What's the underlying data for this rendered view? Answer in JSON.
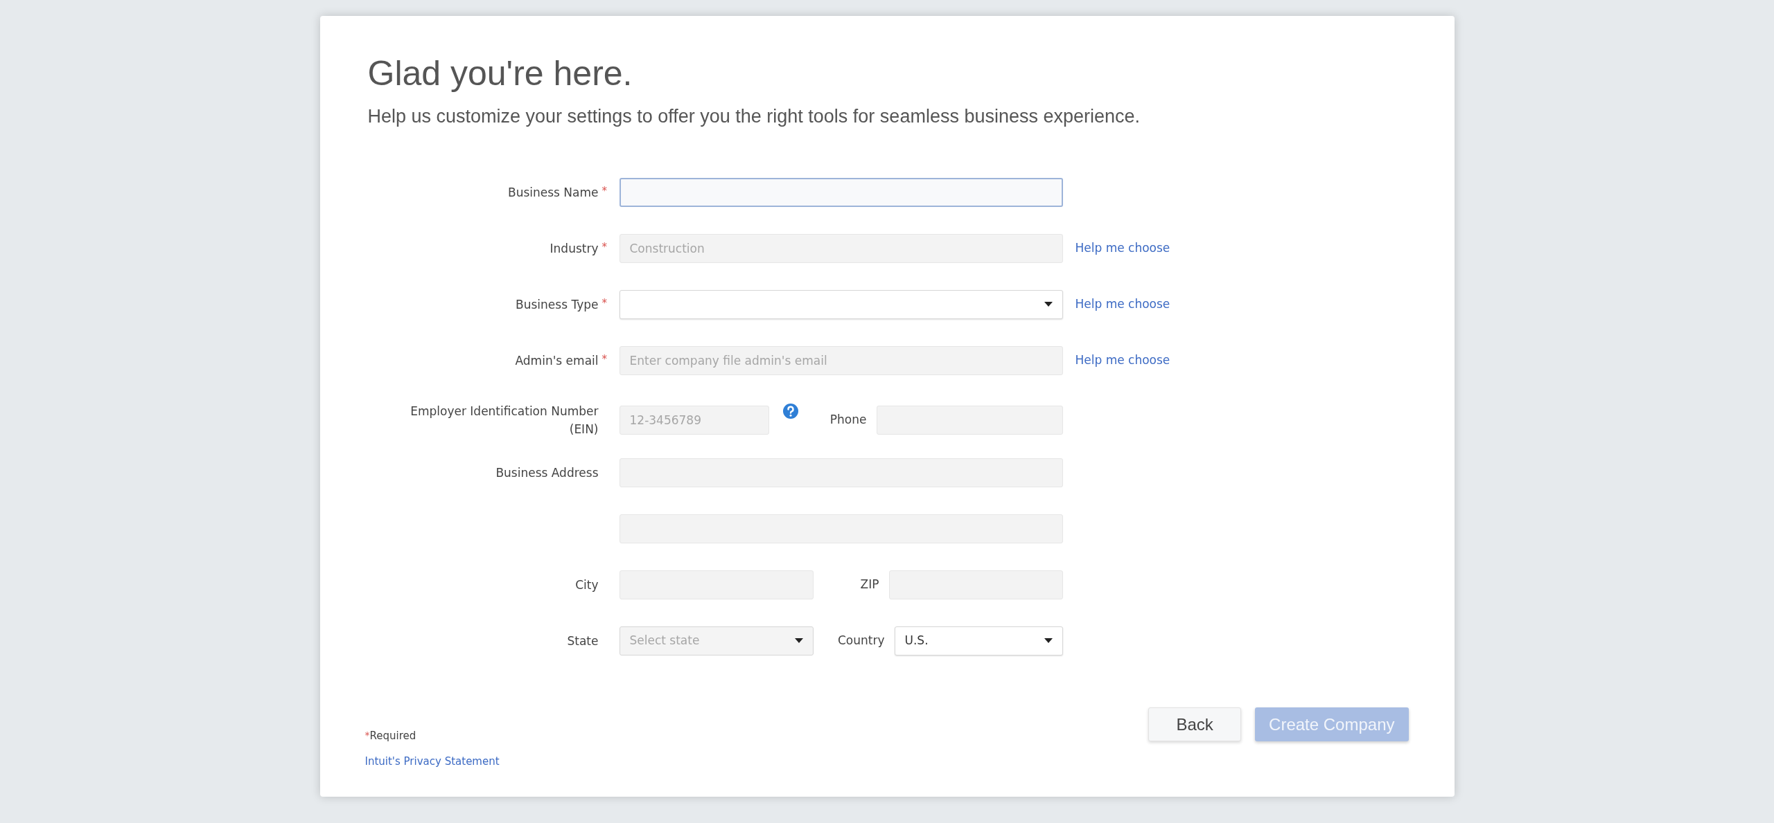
{
  "header": {
    "title": "Glad you're here.",
    "subtitle": "Help us customize your settings to offer you the right tools for seamless business experience."
  },
  "rows": [
    {
      "fields": [
        {
          "label": "Business Name",
          "required": true,
          "kind": "text",
          "focused": true
        }
      ]
    },
    {
      "fields": [
        {
          "label": "Industry",
          "required": true,
          "kind": "text",
          "placeholder": "Construction",
          "focused": false
        }
      ],
      "help": "Help me choose"
    },
    {
      "fields": [
        {
          "label": "Business Type",
          "required": true,
          "kind": "select",
          "focused": false
        }
      ],
      "help": "Help me choose"
    },
    {
      "fields": [
        {
          "label": "Admin's email",
          "required": true,
          "kind": "text",
          "placeholder": "Enter company file admin's email",
          "focused": false
        }
      ],
      "help": "Help me choose"
    },
    {
      "fields": [
        {
          "label": "Employer Identification Number (EIN)",
          "required": false,
          "kind": "text",
          "placeholder": "12-3456789",
          "focused": false,
          "info": true
        },
        {
          "label": "Phone",
          "required": false,
          "kind": "text",
          "focused": false
        }
      ]
    },
    {
      "fields": [
        {
          "label": "Business Address",
          "required": false,
          "kind": "text",
          "focused": false
        }
      ]
    },
    {
      "fields": [
        {
          "kind": "text",
          "focused": false
        }
      ]
    },
    {
      "fields": [
        {
          "label": "City",
          "required": false,
          "kind": "text",
          "focused": false
        },
        {
          "label": "ZIP",
          "required": false,
          "kind": "text",
          "focused": false
        }
      ]
    },
    {
      "fields": [
        {
          "label": "State",
          "required": false,
          "kind": "select",
          "placeholder": "Select state",
          "focused": false
        },
        {
          "label": "Country",
          "required": false,
          "kind": "select",
          "value": "U.S.",
          "focused": false
        }
      ]
    }
  ],
  "footer": {
    "required_mark": "*",
    "required_note": "Required",
    "privacy_link": "Intuit's Privacy Statement"
  },
  "buttons": [
    {
      "label": "Back",
      "kind": "secondary",
      "disabled": false
    },
    {
      "label": "Create Company",
      "kind": "primary",
      "disabled": true
    }
  ]
}
